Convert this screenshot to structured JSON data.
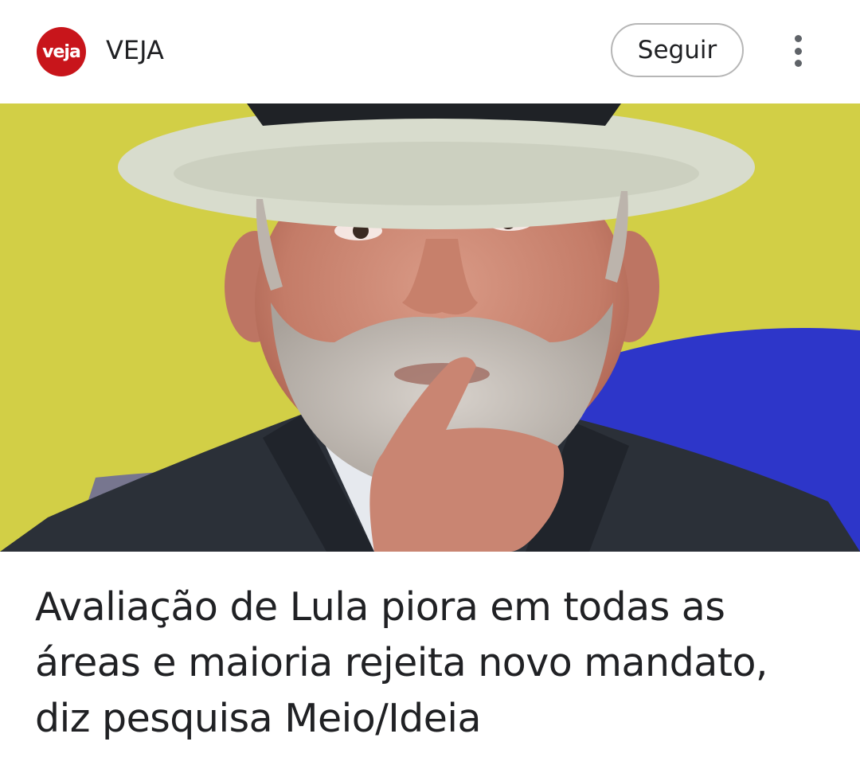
{
  "publisher": {
    "logo_text": "veja",
    "name": "VEJA",
    "logo_color": "#c8151b"
  },
  "actions": {
    "follow_label": "Seguir",
    "more_icon": "more-vert-icon"
  },
  "hero_image": {
    "description_icon": "photo"
  },
  "article": {
    "headline": "Avaliação de Lula piora em todas as áreas e maioria rejeita novo mandato, diz pesquisa Meio/Ideia"
  }
}
